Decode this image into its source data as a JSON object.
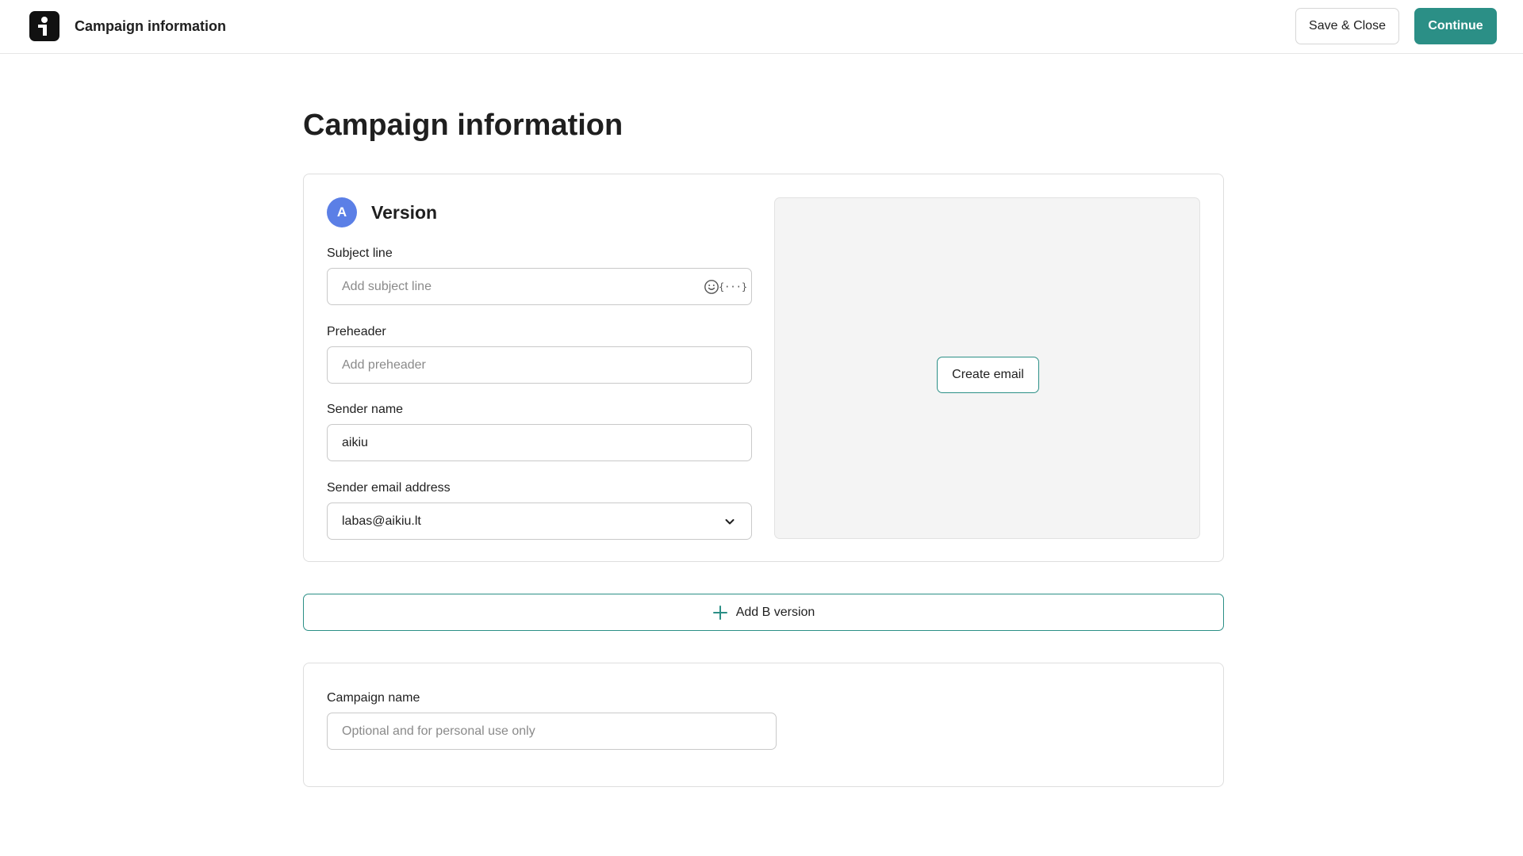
{
  "topbar": {
    "title": "Campaign information",
    "save_close_label": "Save & Close",
    "continue_label": "Continue"
  },
  "page": {
    "title": "Campaign information"
  },
  "version": {
    "badge": "A",
    "title": "Version",
    "subject": {
      "label": "Subject line",
      "placeholder": "Add subject line",
      "variable_icon_text": "{···}"
    },
    "preheader": {
      "label": "Preheader",
      "placeholder": "Add preheader"
    },
    "sender_name": {
      "label": "Sender name",
      "value": "aikiu"
    },
    "sender_email": {
      "label": "Sender email address",
      "value": "labas@aikiu.lt"
    },
    "create_email_label": "Create email"
  },
  "add_b_version_label": "Add B version",
  "campaign": {
    "label": "Campaign name",
    "placeholder": "Optional and for personal use only"
  },
  "colors": {
    "accent": "#2b8f86",
    "badge": "#5b7fe6",
    "logo": "#111111"
  },
  "icons": {
    "logo": "brand-logo-icon",
    "emoji": "smiley-icon",
    "variable": "variable-braces-icon",
    "dropdown": "chevron-down-icon",
    "add": "plus-icon"
  }
}
